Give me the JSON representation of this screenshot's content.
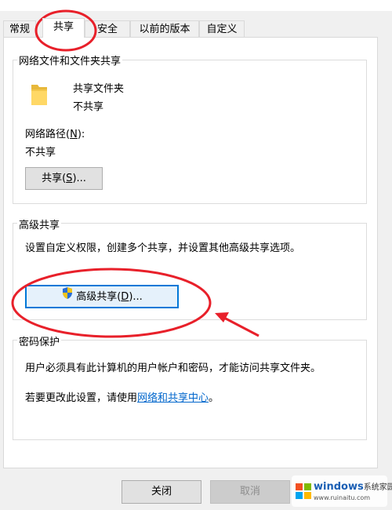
{
  "tabs": [
    {
      "label": "常规",
      "active": false
    },
    {
      "label": "共享",
      "active": true
    },
    {
      "label": "安全",
      "active": false
    },
    {
      "label": "以前的版本",
      "active": false
    },
    {
      "label": "自定义",
      "active": false
    }
  ],
  "network_share": {
    "legend": "网络文件和文件夹共享",
    "folder_icon": "folder-icon",
    "item_name": "共享文件夹",
    "item_status": "不共享",
    "path_label": "网络路径(N):",
    "path_label_prefix": "网络路径(",
    "path_label_key": "N",
    "path_label_suffix": "):",
    "path_value": "不共享",
    "share_button": {
      "prefix": "共享(",
      "key": "S",
      "suffix": ")..."
    }
  },
  "advanced_share": {
    "legend": "高级共享",
    "description": "设置自定义权限，创建多个共享，并设置其他高级共享选项。",
    "button": {
      "prefix": "高级共享(",
      "key": "D",
      "suffix": ")...",
      "icon": "uac-shield-icon"
    }
  },
  "password": {
    "legend": "密码保护",
    "line1": "用户必须具有此计算机的用户帐户和密码，才能访问共享文件夹。",
    "line2_prefix": "若要更改此设置，请使用",
    "line2_link": "网络和共享中心",
    "line2_suffix": "。"
  },
  "footer": {
    "close_label": "关闭",
    "cancel_label": "取消"
  },
  "watermark": {
    "brand": "windows",
    "text": "系统家园",
    "url": "www.ruinaitu.com"
  },
  "colors": {
    "annotation_red": "#e8202a",
    "focus_blue": "#0078d7",
    "link_blue": "#0066cc"
  }
}
